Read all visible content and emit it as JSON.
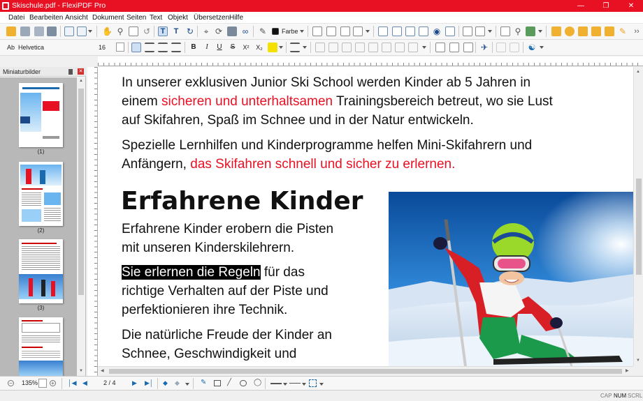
{
  "window": {
    "title": "Skischule.pdf - FlexiPDF Pro"
  },
  "menu": [
    "Datei",
    "Bearbeiten",
    "Ansicht",
    "Dokument",
    "Seiten",
    "Text",
    "Objekt",
    "Übersetzen",
    "Hilfe"
  ],
  "toolbar": {
    "color_label": "Farbe"
  },
  "format": {
    "font_name": "Helvetica",
    "font_size": "16",
    "font_prefix": "Ab"
  },
  "sidebar": {
    "title": "Miniaturbilder",
    "thumbnails": [
      "(1)",
      "(2)",
      "(3)"
    ]
  },
  "document": {
    "p1_a": "In unserer exklusiven Junior Ski School werden Kinder ab 5 Jahren in",
    "p1_b_pre": "einem ",
    "p1_b_red": "sicheren und unterhaltsamen",
    "p1_b_post": " Trainingsbereich betreut, wo sie Lust",
    "p1_c": "auf Skifahren, Spaß im Schnee und in der Natur entwickeln.",
    "p2_a": "Spezielle Lernhilfen und Kinderprogramme helfen Mini-Skifahrern und",
    "p2_b_pre": "Anfängern, ",
    "p2_b_red": "das Skifahren schnell und sicher zu erlernen.",
    "heading": "Erfahrene Kinder",
    "p3_a": "Erfahrene Kinder erobern die Pisten",
    "p3_b": "mit unseren Kinderskilehrern.",
    "p4_sel": "Sie erlernen die Regeln",
    "p4_a_post": " für das",
    "p4_b": "richtige Verhalten auf der Piste und",
    "p4_c": "perfektionieren ihre Technik.",
    "p5_a": "Die natürliche Freude der Kinder an",
    "p5_b": "Schnee, Geschwindigkeit und"
  },
  "bottom": {
    "zoom": "135%",
    "page": "2 / 4"
  },
  "status": {
    "caps": "CAP",
    "num": "NUM",
    "scroll": "SCRL"
  },
  "colors": {
    "accent": "#e81123",
    "text_red": "#e81123"
  }
}
